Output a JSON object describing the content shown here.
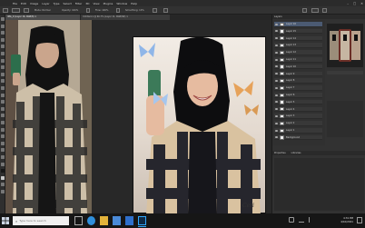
{
  "app": {
    "logo": "Ps",
    "window_controls": [
      "–",
      "□",
      "✕"
    ]
  },
  "menu": [
    "File",
    "Edit",
    "Image",
    "Layer",
    "Type",
    "Select",
    "Filter",
    "3D",
    "View",
    "Plugins",
    "Window",
    "Help"
  ],
  "options": {
    "opacity": "Opacity: 100%",
    "flow": "Flow: 100%",
    "smoothing": "Smoothing: 10%"
  },
  "tabs": [
    {
      "label": "IMG_9 (Layer 16, RGB/8) ×",
      "active": true
    },
    {
      "label": "Untitled-1 @ 66.7% (Layer 11, RGB/8#) ×",
      "active": false
    }
  ],
  "panel": {
    "header": "Layers",
    "layers": [
      "Layer 16",
      "Layer 15",
      "Layer 14",
      "Layer 13",
      "Layer 12",
      "Layer 11",
      "Layer 10",
      "Layer 9",
      "Layer 8",
      "Layer 7",
      "Layer 6",
      "Layer 5",
      "Layer 4",
      "Layer 3",
      "Layer 2",
      "Layer 1",
      "Background"
    ],
    "props": [
      "Properties",
      "Libraries"
    ]
  },
  "artwork": {
    "signature": "Ceri"
  },
  "taskbar": {
    "search_placeholder": "Type here to search",
    "time": "4:31 PM",
    "date": "4/10/2021",
    "icons": [
      "task-view-icon",
      "edge-icon",
      "explorer-icon",
      "store-icon",
      "mail-icon",
      "photoshop-icon"
    ]
  },
  "activation": {
    "line1": "Activate Windows",
    "line2": "Go to Settings to activate Windows."
  },
  "colors": {
    "accent": "#31a8ff",
    "chrome": "#323232",
    "canvas_bg": "#282828",
    "taskbar": "#161616"
  }
}
